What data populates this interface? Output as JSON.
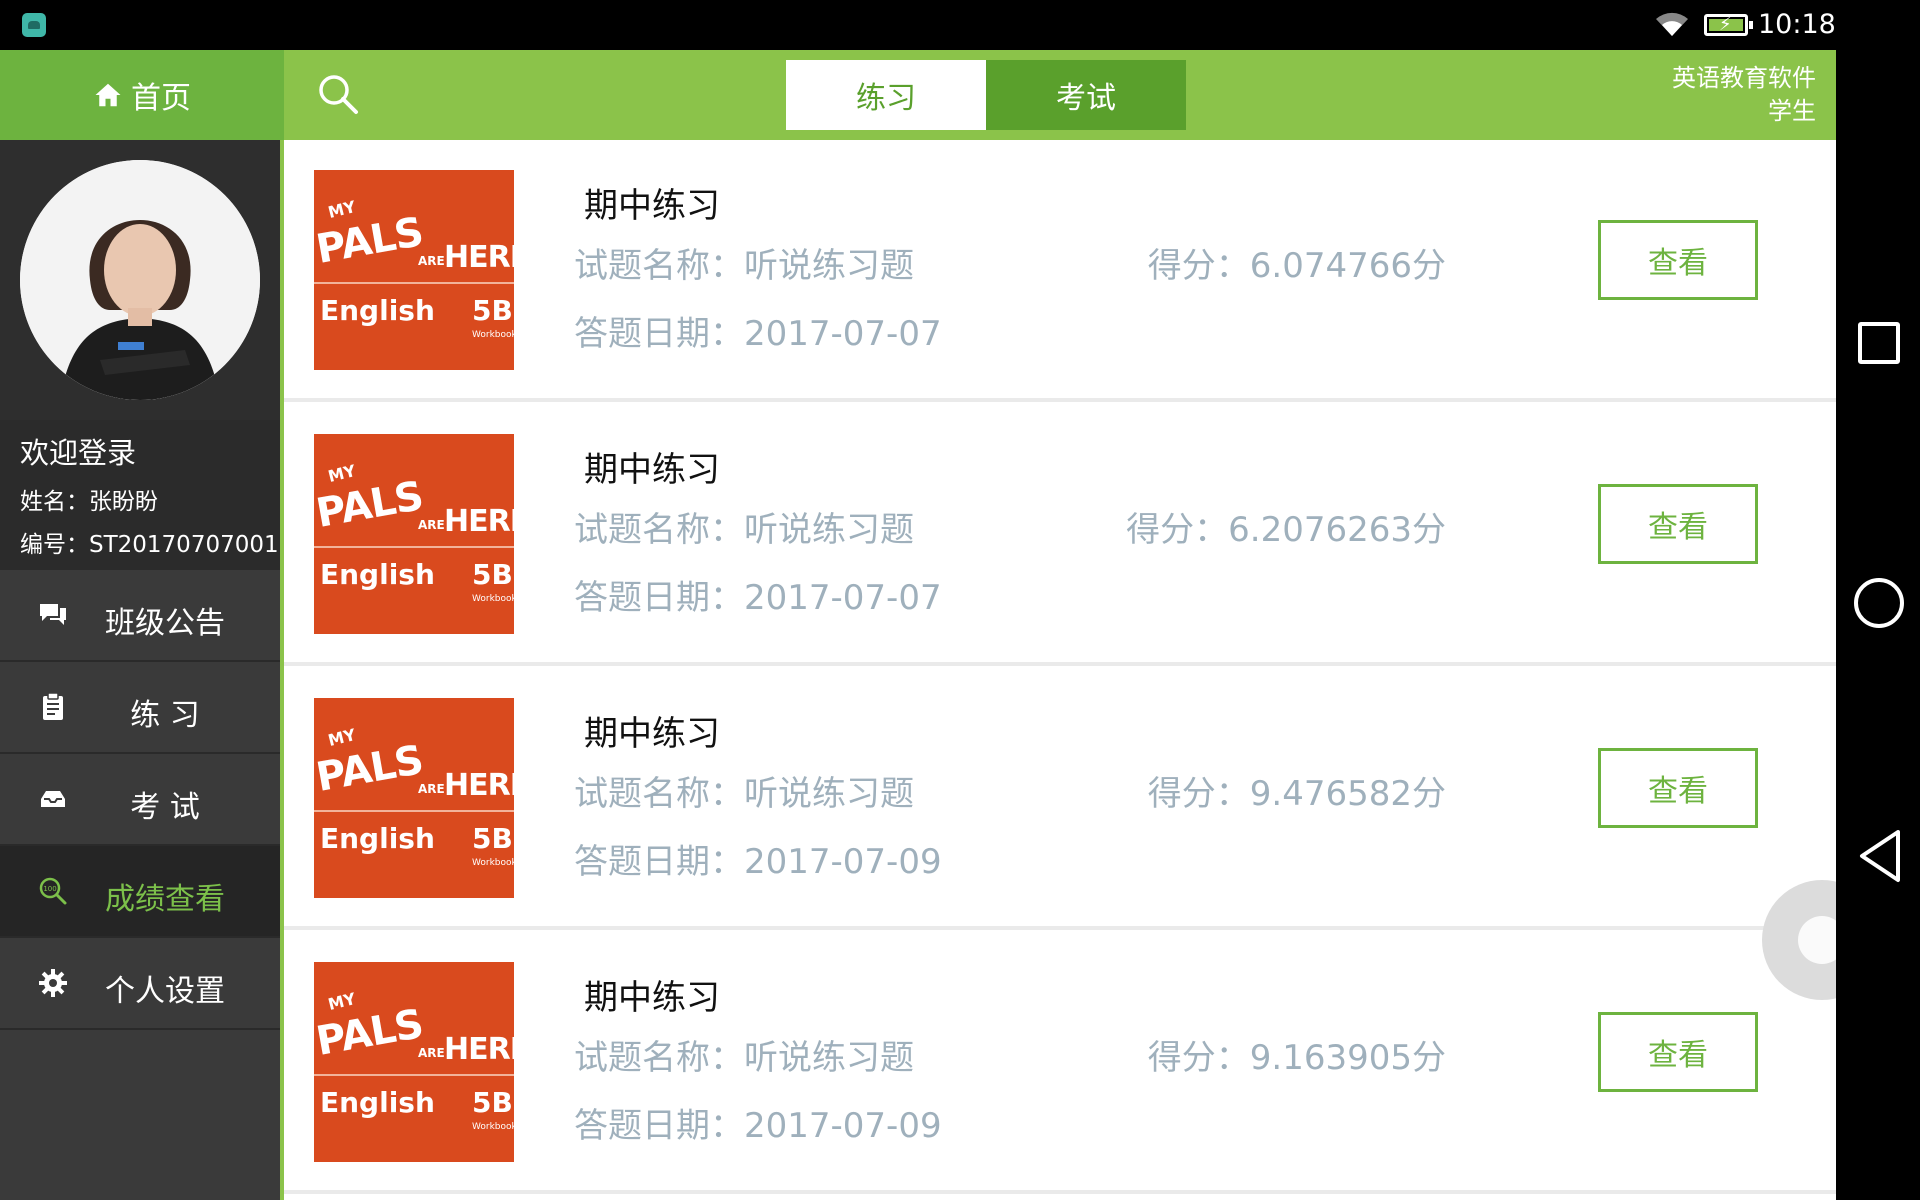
{
  "statusbar": {
    "time": "10:18"
  },
  "topbar": {
    "home_label": "首页",
    "tabs": [
      {
        "label": "练习",
        "active": true
      },
      {
        "label": "考试",
        "active": false
      }
    ],
    "app_name": "英语教育软件",
    "role": "学生"
  },
  "user": {
    "welcome": "欢迎登录",
    "name_line": "姓名：张盼盼",
    "id_line": "编号：ST20170707001"
  },
  "menu": [
    {
      "label": "班级公告",
      "icon": "chat-icon"
    },
    {
      "label": "练 习",
      "icon": "clipboard-icon"
    },
    {
      "label": "考 试",
      "icon": "inbox-icon"
    },
    {
      "label": "成绩查看",
      "icon": "score-search-icon",
      "active": true
    },
    {
      "label": "个人设置",
      "icon": "gear-icon"
    }
  ],
  "records": [
    {
      "title": "期中练习",
      "name": "试题名称：听说练习题",
      "date": "答题日期：2017-07-07",
      "score": "得分：6.074766分",
      "button": "查看"
    },
    {
      "title": "期中练习",
      "name": "试题名称：听说练习题",
      "date": "答题日期：2017-07-07",
      "score": "得分：6.2076263分",
      "button": "查看"
    },
    {
      "title": "期中练习",
      "name": "试题名称：听说练习题",
      "date": "答题日期：2017-07-09",
      "score": "得分：9.476582分",
      "button": "查看"
    },
    {
      "title": "期中练习",
      "name": "试题名称：听说练习题",
      "date": "答题日期：2017-07-09",
      "score": "得分：9.163905分",
      "button": "查看"
    }
  ],
  "cover": {
    "my": "MY",
    "pals": "PALS",
    "are": "ARE",
    "here": "HERE",
    "english": "English",
    "level": "5B",
    "workbook": "Workbook"
  },
  "colors": {
    "primary": "#8bc34a",
    "primary_dark": "#5aa02c",
    "sidebar": "#3a3a3a",
    "muted_text": "#9fb0bc"
  }
}
